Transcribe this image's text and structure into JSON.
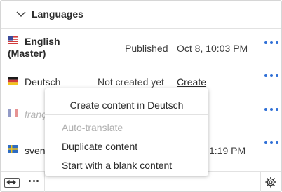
{
  "section": {
    "title": "Languages"
  },
  "rows": [
    {
      "language": "English (Master)",
      "language_line1": "English",
      "language_line2": "(Master)",
      "status": "Published",
      "date": "Oct 8, 10:03 PM",
      "flag": "us-flag-icon"
    },
    {
      "language": "Deutsch",
      "status": "Not created yet",
      "action": "Create",
      "flag": "de-flag-icon"
    },
    {
      "language": "franç",
      "flag": "fr-flag-icon"
    },
    {
      "language": "sven",
      "date": "1:19 PM",
      "flag": "se-flag-icon"
    }
  ],
  "context_menu": {
    "title": "Create content in Deutsch",
    "items": [
      {
        "label": "Auto-translate",
        "disabled": true
      },
      {
        "label": "Duplicate content",
        "disabled": false
      },
      {
        "label": "Start with a blank content",
        "disabled": false
      }
    ]
  },
  "icons": {
    "chevron": "chevron-down-icon",
    "more": "more-options-icon",
    "expand": "expand-horizontal-icon",
    "settings": "gear-icon"
  },
  "colors": {
    "accent": "#2f6fd6",
    "muted_text": "#b0b0b0"
  }
}
